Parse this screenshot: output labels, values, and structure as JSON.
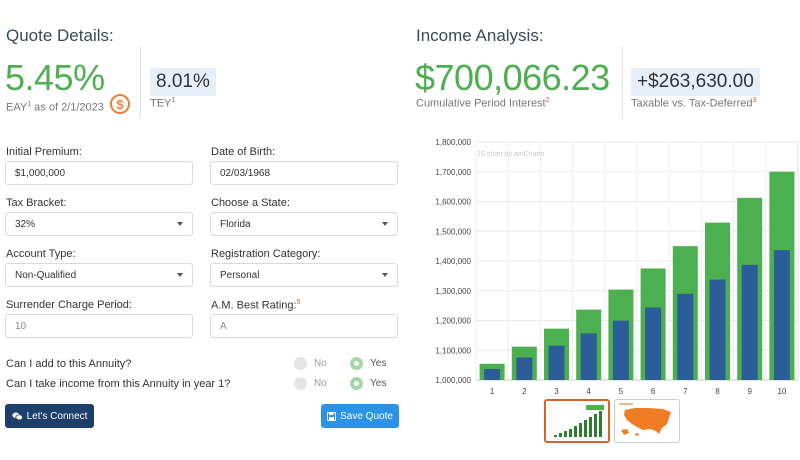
{
  "quote": {
    "title": "Quote Details:",
    "rate": "5.45%",
    "eay_label": "EAY",
    "eay_sup": "1",
    "eay_date": " as of 2/1/2023",
    "tey_value": "8.01%",
    "tey_label": "TEY",
    "tey_sup": "1"
  },
  "income": {
    "title": "Income Analysis:",
    "cumulative_value": "$700,066.23",
    "cumulative_label": "Cumulative Period Interest",
    "cumulative_sup": "2",
    "taxable_value": "+$263,630.00",
    "taxable_label": "Taxable vs. Tax-Deferred",
    "taxable_sup": "3"
  },
  "form": {
    "initial_premium": {
      "label": "Initial Premium:",
      "value": "$1,000,000"
    },
    "date_of_birth": {
      "label": "Date of Birth:",
      "value": "02/03/1968"
    },
    "tax_bracket": {
      "label": "Tax Bracket:",
      "value": "32%"
    },
    "state": {
      "label": "Choose a State:",
      "value": "Florida"
    },
    "account_type": {
      "label": "Account Type:",
      "value": "Non-Qualified"
    },
    "registration": {
      "label": "Registration Category:",
      "value": "Personal"
    },
    "surrender": {
      "label": "Surrender Charge Period:",
      "value": "10"
    },
    "am_best": {
      "label": "A.M. Best Rating:",
      "sup": "5",
      "value": "A"
    }
  },
  "questions": [
    {
      "text": "Can I add to this Annuity?",
      "no": "No",
      "yes": "Yes",
      "selected": "yes"
    },
    {
      "text": "Can I take income from this Annuity in year 1?",
      "no": "No",
      "yes": "Yes",
      "selected": "yes"
    }
  ],
  "buttons": {
    "connect": "Let's Connect",
    "save": "Save Quote"
  },
  "chart_watermark": "JS chart by amCharts",
  "colors": {
    "green": "#4caf50",
    "dark_blue_bar": "#2b5e99",
    "connect_button": "#1d3f6b",
    "save_button": "#2b93e6",
    "accent_orange": "#e8823a"
  },
  "chart_data": {
    "type": "bar",
    "categories": [
      "1",
      "2",
      "3",
      "4",
      "5",
      "6",
      "7",
      "8",
      "9",
      "10"
    ],
    "series": [
      {
        "values": [
          1054500,
          1112000,
          1172600,
          1236500,
          1303900,
          1375000,
          1449900,
          1529000,
          1612300,
          1700066
        ]
      },
      {
        "values": [
          1037100,
          1075500,
          1115300,
          1156600,
          1199400,
          1243800,
          1289800,
          1337500,
          1387000,
          1436400
        ]
      }
    ],
    "ylim": [
      1000000,
      1800000
    ],
    "yticks": [
      "1,000,000",
      "1,100,000",
      "1,200,000",
      "1,300,000",
      "1,400,000",
      "1,500,000",
      "1,600,000",
      "1,700,000",
      "1,800,000"
    ],
    "grid": true,
    "title": "",
    "xlabel": "",
    "ylabel": ""
  }
}
